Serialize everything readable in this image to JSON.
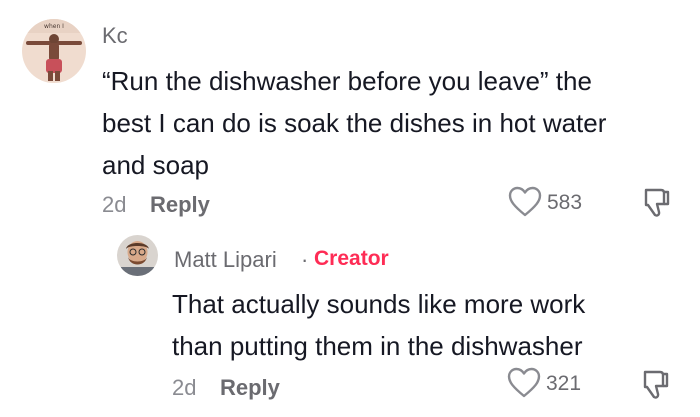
{
  "comment": {
    "username": "Kc",
    "text_lines": [
      "“Run the dishwasher before you leave” the",
      "best I can do is soak the dishes in hot water",
      "and soap"
    ],
    "time": "2d",
    "reply_label": "Reply",
    "like_count": "583",
    "avatar_caption": "when I"
  },
  "reply": {
    "username": "Matt Lipari",
    "separator": "·",
    "badge": "Creator",
    "text_lines": [
      "That actually sounds like more work",
      "than putting them in the dishwasher"
    ],
    "time": "2d",
    "reply_label": "Reply",
    "like_count": "321"
  },
  "colors": {
    "text_primary": "#161823",
    "text_secondary": "#6b6b70",
    "creator_accent": "#fe2c55"
  },
  "icons": {
    "like": "heart-outline-icon",
    "dislike": "thumbs-down-outline-icon"
  }
}
